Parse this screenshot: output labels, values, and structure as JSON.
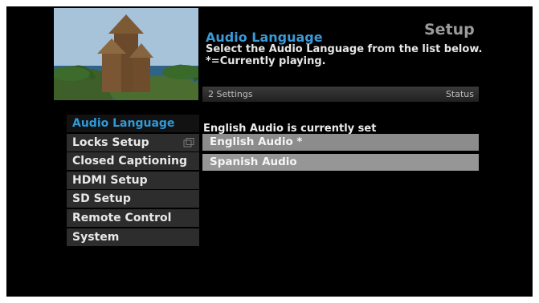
{
  "header": {
    "screen_title": "Setup",
    "section_title": "Audio Language",
    "instructions": "Select the Audio Language from the list below.  *=Currently playing."
  },
  "status_bar": {
    "left": "2 Settings",
    "right": "Status"
  },
  "menu": {
    "items": [
      {
        "label": "Audio Language",
        "active": true
      },
      {
        "label": "Locks Setup",
        "icon": "lock-icon"
      },
      {
        "label": "Closed Captioning"
      },
      {
        "label": "HDMI Setup"
      },
      {
        "label": "SD Setup"
      },
      {
        "label": "Remote Control"
      },
      {
        "label": "System"
      }
    ]
  },
  "content": {
    "current_status": "English Audio is currently set",
    "options": [
      {
        "label": "English Audio *"
      },
      {
        "label": "Spanish Audio"
      }
    ]
  },
  "colors": {
    "accent": "#2f9ad9",
    "background": "#000000"
  }
}
